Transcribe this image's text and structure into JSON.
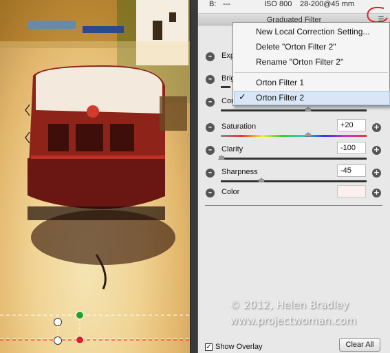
{
  "info": {
    "b_label": "B:",
    "b_value": "---",
    "iso": "ISO 800",
    "lens": "28-200@45 mm"
  },
  "panel": {
    "title": "Graduated Filter",
    "sliders": [
      {
        "label": "Exp",
        "value": "",
        "level": 0.55
      },
      {
        "label": "Brig",
        "value": "",
        "level": 0.5
      },
      {
        "label": "Cor",
        "value": "",
        "level": 0.6
      },
      {
        "label": "Saturation",
        "value": "+20",
        "level": 0.6
      },
      {
        "label": "Clarity",
        "value": "-100",
        "level": 0.0
      },
      {
        "label": "Sharpness",
        "value": "-45",
        "level": 0.28
      }
    ],
    "color_label": "Color",
    "color_value": "#fcf0ee"
  },
  "menu": {
    "items": [
      {
        "label": "New Local Correction Setting..."
      },
      {
        "label": "Delete \"Orton Filter 2\""
      },
      {
        "label": "Rename \"Orton Filter 2\""
      },
      {
        "label": "Orton Filter 1"
      },
      {
        "label": "Orton Filter 2",
        "checked": true
      }
    ]
  },
  "bottom": {
    "show_overlay_label": "Show Overlay",
    "show_overlay_checked": true,
    "done_label": "Clear All"
  },
  "watermark": {
    "line1": "© 2012, Helen Bradley",
    "line2": "www.projectwoman.com"
  },
  "colors": {
    "boat_red": "#b0221a",
    "accent_red": "#e02020",
    "overlay_green": "#22a022"
  }
}
